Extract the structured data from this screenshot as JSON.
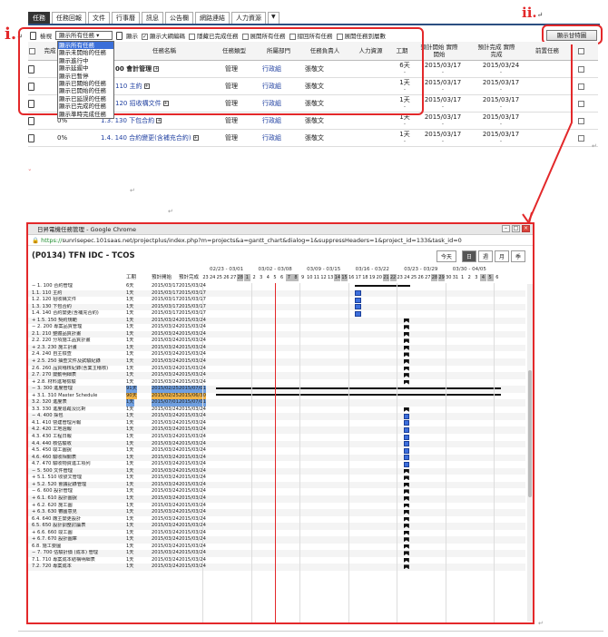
{
  "top_tabs": [
    "任務",
    "任務回報",
    "文件",
    "行事曆",
    "訊息",
    "公告欄",
    "網路連結",
    "人力資源"
  ],
  "tab_dropdown": "▼",
  "annotations": {
    "i": "i.",
    "ii": "ii.",
    "return_mark": "↵"
  },
  "gantt_button": "顯示甘特圖",
  "options": {
    "edit_label": "檢視",
    "select_value": "顯示所有任務",
    "show_label": "顯示",
    "show_wbs": "顯示大綱編碼",
    "hide_done": "隱藏已完成任務",
    "expand_all": "展開所有任務",
    "collapse_all": "摺回所有任務",
    "expand_to_level": "展開任務到層數"
  },
  "dropdown_options": [
    "顯示所有任務",
    "顯示未開始的任務",
    "顯示進行中",
    "顯示延遲中",
    "顯示已暫停",
    "顯示已關始的任務",
    "顯示已開始的任務",
    "顯示已延誤的任務",
    "顯示已完成的任務",
    "顯示準時完成任務"
  ],
  "table": {
    "headers": [
      "完成",
      "任務名稱",
      "任務類型",
      "所屬部門",
      "任務負責人",
      "人力資源",
      "工期",
      "預計開始 實際開始",
      "預計完成 實際完成",
      "前置任務"
    ],
    "rows": [
      {
        "done": "",
        "name": "00 會計管理",
        "type": "管理",
        "dept": "行政組",
        "owner": "張敬文",
        "hr": "",
        "dur": "6天",
        "start": "2015/03/17",
        "end": "2015/03/24"
      },
      {
        "done": "",
        "name": "110 主約",
        "type": "管理",
        "dept": "行政組",
        "owner": "張敬文",
        "hr": "",
        "dur": "1天",
        "start": "2015/03/17",
        "end": "2015/03/17"
      },
      {
        "done": "",
        "name": "120 招收構文件",
        "type": "管理",
        "dept": "行政組",
        "owner": "張敬文",
        "hr": "",
        "dur": "1天",
        "start": "2015/03/17",
        "end": "2015/03/17"
      },
      {
        "done": "0%",
        "name": "1.3. 130 下包合約",
        "type": "管理",
        "dept": "行政組",
        "owner": "張敬文",
        "hr": "",
        "dur": "1天",
        "start": "2015/03/17",
        "end": "2015/03/17"
      },
      {
        "done": "0%",
        "name": "1.4. 140 合約變更(含補充合約)",
        "type": "管理",
        "dept": "行政組",
        "owner": "張敬文",
        "hr": "",
        "dur": "1天",
        "start": "2015/03/17",
        "end": "2015/03/17"
      }
    ]
  },
  "browser": {
    "title": "日昇電機任務管理 - Google Chrome",
    "url_scheme": "https://",
    "url_rest": "sunrisepec.101saas.net/projectplus/index.php?m=projects&a=gantt_chart&dialog=1&suppressHeaders=1&project_id=133&task_id=0",
    "project_title": "(P0134) TFN IDC - TCOS",
    "view_buttons": [
      "今天",
      "日",
      "週",
      "月",
      "季"
    ],
    "col_headers": [
      "工期",
      "預計開始",
      "預計完成"
    ],
    "weeks": [
      "02/23 - 03/01",
      "03/02 - 03/08",
      "03/09 - 03/15",
      "03/16 - 03/22",
      "03/23 - 03/29",
      "03/30 - 04/05"
    ],
    "days": [
      "23",
      "24",
      "25",
      "26",
      "27",
      "28",
      "1",
      "2",
      "3",
      "4",
      "5",
      "6",
      "7",
      "8",
      "9",
      "10",
      "11",
      "12",
      "13",
      "14",
      "15",
      "16",
      "17",
      "18",
      "19",
      "20",
      "21",
      "22",
      "23",
      "24",
      "25",
      "26",
      "27",
      "28",
      "29",
      "30",
      "31",
      "1",
      "2",
      "3",
      "4",
      "5",
      "6"
    ]
  },
  "gantt_rows": [
    {
      "name": "− 1. 100 合約管理",
      "dur": "6天",
      "start": "2015/03/17",
      "end": "2015/03/24",
      "bar": "blk",
      "from": 22,
      "len": 8
    },
    {
      "name": "1.1. 110 主約",
      "dur": "1天",
      "start": "2015/03/17",
      "end": "2015/03/17",
      "bar": "blue",
      "from": 22,
      "len": 1
    },
    {
      "name": "1.2. 120 招收構文件",
      "dur": "1天",
      "start": "2015/03/17",
      "end": "2015/03/17",
      "bar": "blue",
      "from": 22,
      "len": 1
    },
    {
      "name": "1.3. 130 下包合約",
      "dur": "1天",
      "start": "2015/03/17",
      "end": "2015/03/17",
      "bar": "blue",
      "from": 22,
      "len": 1
    },
    {
      "name": "1.4. 140 合約變更(含補充合約)",
      "dur": "1天",
      "start": "2015/03/17",
      "end": "2015/03/17",
      "bar": "blue",
      "from": 22,
      "len": 1
    },
    {
      "name": "+ 1.5. 150 契約規範",
      "dur": "1天",
      "start": "2015/03/24",
      "end": "2015/03/24",
      "bar": "mile",
      "from": 29,
      "len": 1
    },
    {
      "name": "− 2. 200 專案品質管理",
      "dur": "1天",
      "start": "2015/03/24",
      "end": "2015/03/24",
      "bar": "mile",
      "from": 29,
      "len": 1
    },
    {
      "name": "2.1. 210 整體品質計畫",
      "dur": "1天",
      "start": "2015/03/24",
      "end": "2015/03/24",
      "bar": "mile",
      "from": 29,
      "len": 1
    },
    {
      "name": "2.2. 220 分項施工品質計畫",
      "dur": "1天",
      "start": "2015/03/24",
      "end": "2015/03/24",
      "bar": "mile",
      "from": 29,
      "len": 1
    },
    {
      "name": "+ 2.3. 230 施工計畫",
      "dur": "1天",
      "start": "2015/03/24",
      "end": "2015/03/24",
      "bar": "mile",
      "from": 29,
      "len": 1
    },
    {
      "name": "2.4. 240 自主檢查",
      "dur": "1天",
      "start": "2015/03/24",
      "end": "2015/03/24",
      "bar": "mile",
      "from": 29,
      "len": 1
    },
    {
      "name": "+ 2.5. 250 抽查文件及試驗紀錄",
      "dur": "1天",
      "start": "2015/03/24",
      "end": "2015/03/24",
      "bar": "mile",
      "from": 29,
      "len": 1
    },
    {
      "name": "2.6. 260 品質稽核紀錄(含業主稽核)",
      "dur": "1天",
      "start": "2015/03/24",
      "end": "2015/03/24",
      "bar": "mile",
      "from": 29,
      "len": 1
    },
    {
      "name": "2.7. 270 變動明細表",
      "dur": "1天",
      "start": "2015/03/24",
      "end": "2015/03/24",
      "bar": "mile",
      "from": 29,
      "len": 1
    },
    {
      "name": "+ 2.8. 材料進場檢驗",
      "dur": "1天",
      "start": "2015/03/24",
      "end": "2015/03/24",
      "bar": "mile",
      "from": 29,
      "len": 1
    },
    {
      "name": "− 3. 300 進度管理",
      "dur": "91天",
      "start": "2015/02/25",
      "end": "2015/07/01",
      "bar": "blk",
      "from": 2,
      "len": 41,
      "hl": "hl2"
    },
    {
      "name": "+ 3.1. 310 Master Schedule",
      "dur": "90天",
      "start": "2015/02/25",
      "end": "2015/06/30",
      "bar": "blk",
      "from": 2,
      "len": 41,
      "hl": "hl"
    },
    {
      "name": "3.2. 320 進度表",
      "dur": "1天",
      "start": "2015/07/01",
      "end": "2015/07/01",
      "bar": "",
      "from": 0,
      "len": 0,
      "hl": "hl2"
    },
    {
      "name": "3.3. 330 進度追蹤及比對",
      "dur": "1天",
      "start": "2015/03/24",
      "end": "2015/03/24",
      "bar": "mile",
      "from": 29,
      "len": 1
    },
    {
      "name": "− 4. 400 採包",
      "dur": "1天",
      "start": "2015/03/24",
      "end": "2015/03/24",
      "bar": "blue",
      "from": 29,
      "len": 1
    },
    {
      "name": "4.1. 410 營建管理月報",
      "dur": "1天",
      "start": "2015/03/24",
      "end": "2015/03/24",
      "bar": "blue",
      "from": 29,
      "len": 1
    },
    {
      "name": "4.2. 420 工地週報",
      "dur": "1天",
      "start": "2015/03/24",
      "end": "2015/03/24",
      "bar": "blue",
      "from": 29,
      "len": 1
    },
    {
      "name": "4.3. 430 工程日報",
      "dur": "1天",
      "start": "2015/03/24",
      "end": "2015/03/24",
      "bar": "blue",
      "from": 29,
      "len": 1
    },
    {
      "name": "4.4. 440 核估驗收",
      "dur": "1天",
      "start": "2015/03/24",
      "end": "2015/03/24",
      "bar": "blue",
      "from": 29,
      "len": 1
    },
    {
      "name": "4.5. 450 竣工圖說",
      "dur": "1天",
      "start": "2015/03/24",
      "end": "2015/03/24",
      "bar": "blue",
      "from": 29,
      "len": 1
    },
    {
      "name": "4.6. 460 驗收相關表",
      "dur": "1天",
      "start": "2015/03/24",
      "end": "2015/03/24",
      "bar": "blue",
      "from": 29,
      "len": 1
    },
    {
      "name": "4.7. 470 驗收物資進工項列",
      "dur": "1天",
      "start": "2015/03/24",
      "end": "2015/03/24",
      "bar": "blue",
      "from": 29,
      "len": 1
    },
    {
      "name": "− 5. 500 文件管理",
      "dur": "1天",
      "start": "2015/03/24",
      "end": "2015/03/24",
      "bar": "mile",
      "from": 29,
      "len": 1
    },
    {
      "name": "+ 5.1. 510 收發文管理",
      "dur": "1天",
      "start": "2015/03/24",
      "end": "2015/03/24",
      "bar": "mile",
      "from": 29,
      "len": 1
    },
    {
      "name": "+ 5.2. 520 會議記錄管理",
      "dur": "1天",
      "start": "2015/03/24",
      "end": "2015/03/24",
      "bar": "mile",
      "from": 29,
      "len": 1
    },
    {
      "name": "− 6. 600 設計管理",
      "dur": "1天",
      "start": "2015/03/24",
      "end": "2015/03/24",
      "bar": "mile",
      "from": 29,
      "len": 1
    },
    {
      "name": "+ 6.1. 610 設計圖說",
      "dur": "1天",
      "start": "2015/03/24",
      "end": "2015/03/24",
      "bar": "mile",
      "from": 29,
      "len": 1
    },
    {
      "name": "+ 6.2. 620 施工圖",
      "dur": "1天",
      "start": "2015/03/24",
      "end": "2015/03/24",
      "bar": "mile",
      "from": 29,
      "len": 1
    },
    {
      "name": "+ 6.3. 630 審圖意見",
      "dur": "1天",
      "start": "2015/03/24",
      "end": "2015/03/24",
      "bar": "mile",
      "from": 29,
      "len": 1
    },
    {
      "name": "6.4. 640 廠主變更設計",
      "dur": "1天",
      "start": "2015/03/24",
      "end": "2015/03/24",
      "bar": "mile",
      "from": 29,
      "len": 1
    },
    {
      "name": "6.5. 650 設計調整討論表",
      "dur": "1天",
      "start": "2015/03/24",
      "end": "2015/03/24",
      "bar": "mile",
      "from": 29,
      "len": 1
    },
    {
      "name": "+ 6.6. 660 竣工圖",
      "dur": "1天",
      "start": "2015/03/24",
      "end": "2015/03/24",
      "bar": "mile",
      "from": 29,
      "len": 1
    },
    {
      "name": "+ 6.7. 670 設計圖庫",
      "dur": "1天",
      "start": "2015/03/24",
      "end": "2015/03/24",
      "bar": "mile",
      "from": 29,
      "len": 1
    },
    {
      "name": "6.8. 施工要圖",
      "dur": "1天",
      "start": "2015/03/24",
      "end": "2015/03/24",
      "bar": "mile",
      "from": 29,
      "len": 1
    },
    {
      "name": "− 7. 700 估驗計價 (成本) 管理",
      "dur": "1天",
      "start": "2015/03/24",
      "end": "2015/03/24",
      "bar": "mile",
      "from": 29,
      "len": 1
    },
    {
      "name": "7.1. 710 專案成本結構明細表",
      "dur": "1天",
      "start": "2015/03/24",
      "end": "2015/03/24",
      "bar": "mile",
      "from": 29,
      "len": 1
    },
    {
      "name": "7.2. 720 專案成本",
      "dur": "1天",
      "start": "2015/03/24",
      "end": "2015/03/24",
      "bar": "mile",
      "from": 29,
      "len": 1
    }
  ]
}
